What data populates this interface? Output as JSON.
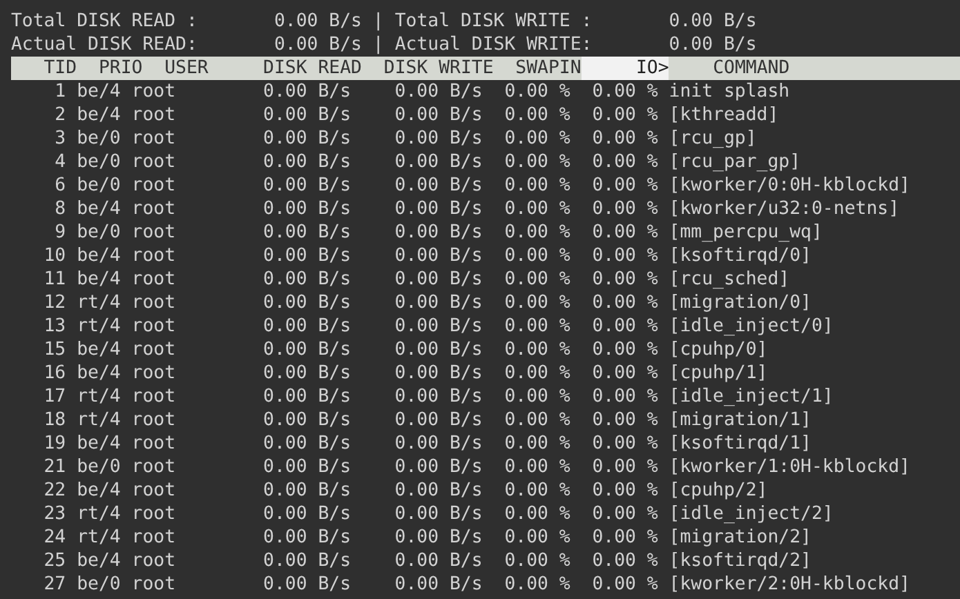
{
  "summary": [
    {
      "read_label": "Total DISK READ :",
      "read_value": "0.00 B/s",
      "separator": "|",
      "write_label": "Total DISK WRITE :",
      "write_value": "0.00 B/s"
    },
    {
      "read_label": "Actual DISK READ:",
      "read_value": "0.00 B/s",
      "separator": "|",
      "write_label": "Actual DISK WRITE:",
      "write_value": "0.00 B/s"
    }
  ],
  "columns": [
    {
      "label": "TID",
      "sorted": false
    },
    {
      "label": "PRIO",
      "sorted": false
    },
    {
      "label": "USER",
      "sorted": false
    },
    {
      "label": "DISK READ",
      "sorted": false
    },
    {
      "label": "DISK WRITE",
      "sorted": false
    },
    {
      "label": "SWAPIN",
      "sorted": false
    },
    {
      "label": "IO>",
      "sorted": true
    },
    {
      "label": "COMMAND",
      "sorted": false
    }
  ],
  "rows": [
    [
      "1",
      "be/4",
      "root",
      "0.00 B/s",
      "0.00 B/s",
      "0.00 %",
      "0.00 %",
      "init splash"
    ],
    [
      "2",
      "be/4",
      "root",
      "0.00 B/s",
      "0.00 B/s",
      "0.00 %",
      "0.00 %",
      "[kthreadd]"
    ],
    [
      "3",
      "be/0",
      "root",
      "0.00 B/s",
      "0.00 B/s",
      "0.00 %",
      "0.00 %",
      "[rcu_gp]"
    ],
    [
      "4",
      "be/0",
      "root",
      "0.00 B/s",
      "0.00 B/s",
      "0.00 %",
      "0.00 %",
      "[rcu_par_gp]"
    ],
    [
      "6",
      "be/0",
      "root",
      "0.00 B/s",
      "0.00 B/s",
      "0.00 %",
      "0.00 %",
      "[kworker/0:0H-kblockd]"
    ],
    [
      "8",
      "be/4",
      "root",
      "0.00 B/s",
      "0.00 B/s",
      "0.00 %",
      "0.00 %",
      "[kworker/u32:0-netns]"
    ],
    [
      "9",
      "be/0",
      "root",
      "0.00 B/s",
      "0.00 B/s",
      "0.00 %",
      "0.00 %",
      "[mm_percpu_wq]"
    ],
    [
      "10",
      "be/4",
      "root",
      "0.00 B/s",
      "0.00 B/s",
      "0.00 %",
      "0.00 %",
      "[ksoftirqd/0]"
    ],
    [
      "11",
      "be/4",
      "root",
      "0.00 B/s",
      "0.00 B/s",
      "0.00 %",
      "0.00 %",
      "[rcu_sched]"
    ],
    [
      "12",
      "rt/4",
      "root",
      "0.00 B/s",
      "0.00 B/s",
      "0.00 %",
      "0.00 %",
      "[migration/0]"
    ],
    [
      "13",
      "rt/4",
      "root",
      "0.00 B/s",
      "0.00 B/s",
      "0.00 %",
      "0.00 %",
      "[idle_inject/0]"
    ],
    [
      "15",
      "be/4",
      "root",
      "0.00 B/s",
      "0.00 B/s",
      "0.00 %",
      "0.00 %",
      "[cpuhp/0]"
    ],
    [
      "16",
      "be/4",
      "root",
      "0.00 B/s",
      "0.00 B/s",
      "0.00 %",
      "0.00 %",
      "[cpuhp/1]"
    ],
    [
      "17",
      "rt/4",
      "root",
      "0.00 B/s",
      "0.00 B/s",
      "0.00 %",
      "0.00 %",
      "[idle_inject/1]"
    ],
    [
      "18",
      "rt/4",
      "root",
      "0.00 B/s",
      "0.00 B/s",
      "0.00 %",
      "0.00 %",
      "[migration/1]"
    ],
    [
      "19",
      "be/4",
      "root",
      "0.00 B/s",
      "0.00 B/s",
      "0.00 %",
      "0.00 %",
      "[ksoftirqd/1]"
    ],
    [
      "21",
      "be/0",
      "root",
      "0.00 B/s",
      "0.00 B/s",
      "0.00 %",
      "0.00 %",
      "[kworker/1:0H-kblockd]"
    ],
    [
      "22",
      "be/4",
      "root",
      "0.00 B/s",
      "0.00 B/s",
      "0.00 %",
      "0.00 %",
      "[cpuhp/2]"
    ],
    [
      "23",
      "rt/4",
      "root",
      "0.00 B/s",
      "0.00 B/s",
      "0.00 %",
      "0.00 %",
      "[idle_inject/2]"
    ],
    [
      "24",
      "rt/4",
      "root",
      "0.00 B/s",
      "0.00 B/s",
      "0.00 %",
      "0.00 %",
      "[migration/2]"
    ],
    [
      "25",
      "be/4",
      "root",
      "0.00 B/s",
      "0.00 B/s",
      "0.00 %",
      "0.00 %",
      "[ksoftirqd/2]"
    ],
    [
      "27",
      "be/0",
      "root",
      "0.00 B/s",
      "0.00 B/s",
      "0.00 %",
      "0.00 %",
      "[kworker/2:0H-kblockd]"
    ]
  ]
}
